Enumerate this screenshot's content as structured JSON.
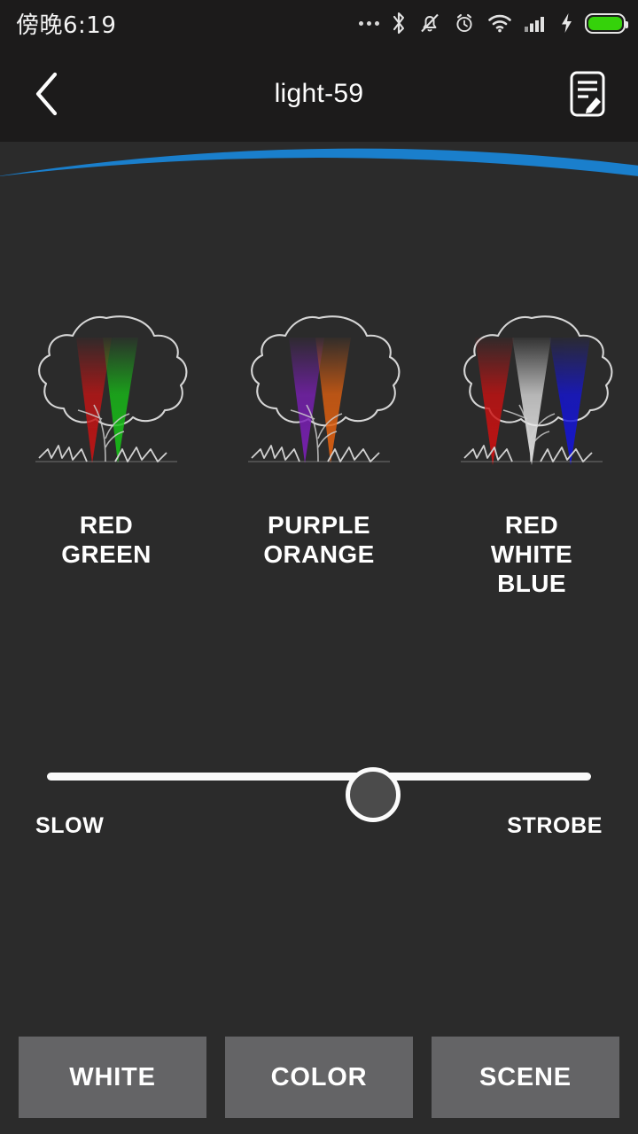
{
  "statusbar": {
    "time": "傍晚6:19",
    "icons": [
      {
        "name": "more-dots-icon"
      },
      {
        "name": "bluetooth-icon"
      },
      {
        "name": "bell-muted-icon"
      },
      {
        "name": "alarm-clock-icon"
      },
      {
        "name": "wifi-icon"
      },
      {
        "name": "cellular-signal-icon"
      },
      {
        "name": "charging-bolt-icon"
      },
      {
        "name": "battery-icon"
      }
    ],
    "battery_color": "#35d20a"
  },
  "header": {
    "title": "light-59",
    "back_icon": "chevron-left-icon",
    "edit_icon": "document-edit-icon",
    "accent_color": "#1a7fcc",
    "background": "#1c1b1b"
  },
  "main": {
    "background": "#2b2b2b",
    "scenes": [
      {
        "id": "red-green",
        "label": "RED\nGREEN",
        "label_lines": [
          "RED",
          "GREEN"
        ],
        "beams": [
          {
            "color": "#c41414"
          },
          {
            "color": "#17bf17"
          }
        ]
      },
      {
        "id": "purple-orange",
        "label": "PURPLE\nORANGE",
        "label_lines": [
          "PURPLE",
          "ORANGE"
        ],
        "beams": [
          {
            "color": "#7a1fb5"
          },
          {
            "color": "#e06010"
          }
        ]
      },
      {
        "id": "red-white-blue",
        "label": "RED\nWHITE\nBLUE",
        "label_lines": [
          "RED",
          "WHITE",
          "BLUE"
        ],
        "beams": [
          {
            "color": "#cc1111"
          },
          {
            "color": "#e8e8e8"
          },
          {
            "color": "#1414d8"
          }
        ]
      }
    ]
  },
  "slider": {
    "name": "speed-slider",
    "min_label": "SLOW",
    "max_label": "STROBE",
    "value_percent": 60,
    "track_color": "#fafafa",
    "thumb_color": "#4b4b4b"
  },
  "tabs": [
    {
      "id": "white",
      "label": "WHITE"
    },
    {
      "id": "color",
      "label": "COLOR"
    },
    {
      "id": "scene",
      "label": "SCENE"
    }
  ]
}
